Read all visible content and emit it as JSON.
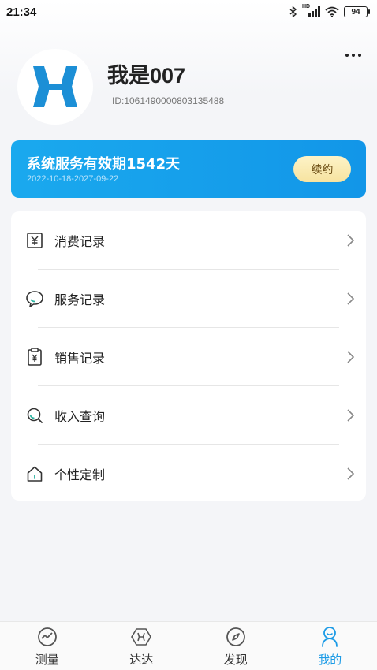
{
  "status_bar": {
    "time": "21:34",
    "network": "HD",
    "battery": "94"
  },
  "profile": {
    "name": "我是007",
    "id": "ID:1061490000803135488"
  },
  "service": {
    "title": "系统服务有效期1542天",
    "dates": "2022-10-18-2027-09-22",
    "renew_label": "续约"
  },
  "menu": {
    "items": [
      {
        "label": "消费记录",
        "icon": "yuan-receipt-icon"
      },
      {
        "label": "服务记录",
        "icon": "chat-bubble-icon"
      },
      {
        "label": "销售记录",
        "icon": "clipboard-yuan-icon"
      },
      {
        "label": "收入查询",
        "icon": "search-icon"
      },
      {
        "label": "个性定制",
        "icon": "home-icon"
      }
    ]
  },
  "tabs": [
    {
      "label": "测量",
      "icon": "chart-circle-icon"
    },
    {
      "label": "达达",
      "icon": "hex-logo-icon"
    },
    {
      "label": "发现",
      "icon": "compass-icon"
    },
    {
      "label": "我的",
      "icon": "person-icon",
      "active": true
    }
  ],
  "colors": {
    "accent": "#1c9be6",
    "card_blue": "#1aa9ee",
    "renew_gold": "#f7e3a0"
  }
}
